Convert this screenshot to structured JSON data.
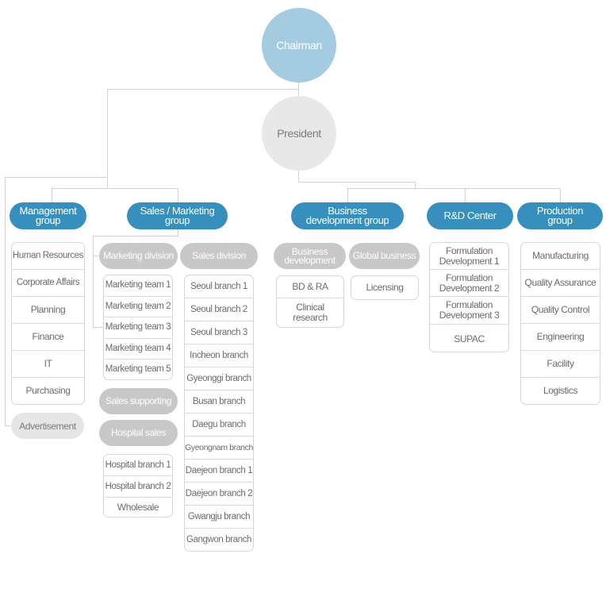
{
  "chairman": "Chairman",
  "president": "President",
  "groups": {
    "management": {
      "label": "Management group",
      "items": [
        "Human Resources",
        "Corporate Affairs",
        "Planning",
        "Finance",
        "IT",
        "Purchasing"
      ],
      "advertisement": "Advertisement"
    },
    "sales_marketing": {
      "label": "Sales / Marketing group",
      "marketing_division": "Marketing division",
      "marketing_teams": [
        "Marketing team 1",
        "Marketing team 2",
        "Marketing team 3",
        "Marketing team 4",
        "Marketing team 5"
      ],
      "sales_supporting": "Sales supporting",
      "hospital_sales": "Hospital sales",
      "hospital_items": [
        "Hospital branch 1",
        "Hospital branch 2",
        "Wholesale"
      ],
      "sales_division": "Sales division",
      "branches": [
        "Seoul branch 1",
        "Seoul branch 2",
        "Seoul branch 3",
        "Incheon branch",
        "Gyeonggi branch",
        "Busan branch",
        "Daegu branch",
        "Gyeongnam branch",
        "Daejeon branch 1",
        "Daejeon branch 2",
        "Gwangju branch",
        "Gangwon branch"
      ]
    },
    "business_dev": {
      "label": "Business development group",
      "bd_pill": "Business development",
      "bd_items": [
        "BD & RA",
        "Clinical research"
      ],
      "global_pill": "Global business",
      "global_items": [
        "Licensing"
      ]
    },
    "rnd": {
      "label": "R&D Center",
      "items": [
        "Formulation Development 1",
        "Formulation Development 2",
        "Formulation Development 3",
        "SUPAC"
      ]
    },
    "production": {
      "label": "Production group",
      "items": [
        "Manufacturing",
        "Quality Assurance",
        "Quality Control",
        "Engineering",
        "Facility",
        "Logistics"
      ]
    }
  },
  "colors": {
    "chairman": "#a5cbe1",
    "president": "#e8e8e8",
    "group": "#368fbd",
    "subdivision": "#c8c8c8",
    "connector": "#d3d3d3"
  }
}
